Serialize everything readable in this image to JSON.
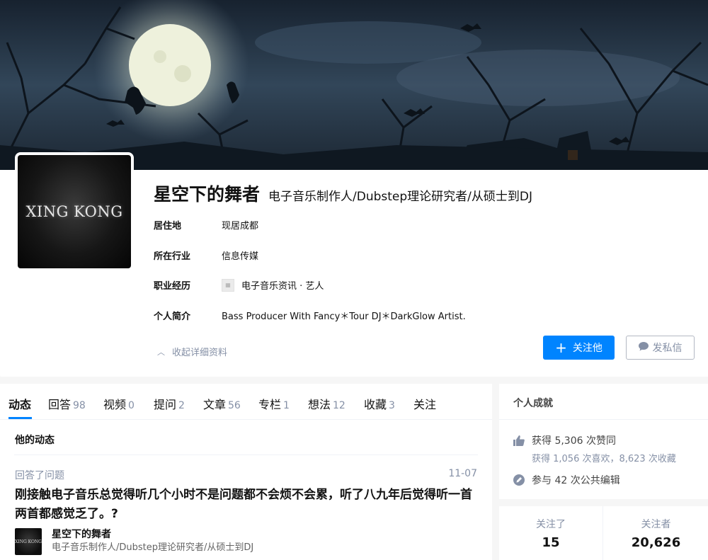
{
  "profile": {
    "name": "星空下的舞者",
    "headline": "电子音乐制作人/Dubstep理论研究者/从硕士到DJ",
    "avatar_text": "XING KONG",
    "details": [
      {
        "label": "居住地",
        "value": "现居成都"
      },
      {
        "label": "所在行业",
        "value": "信息传媒"
      },
      {
        "label": "职业经历",
        "value": "电子音乐资讯 · 艺人"
      },
      {
        "label": "个人简介",
        "value": "Bass Producer With Fancy＊Tour DJ＊DarkGlow Artist."
      }
    ],
    "collapse_label": "收起详细资料",
    "follow_button": "关注他",
    "message_button": "发私信"
  },
  "tabs": [
    {
      "label": "动态",
      "count": ""
    },
    {
      "label": "回答",
      "count": "98"
    },
    {
      "label": "视频",
      "count": "0"
    },
    {
      "label": "提问",
      "count": "2"
    },
    {
      "label": "文章",
      "count": "56"
    },
    {
      "label": "专栏",
      "count": "1"
    },
    {
      "label": "想法",
      "count": "12"
    },
    {
      "label": "收藏",
      "count": "3"
    },
    {
      "label": "关注",
      "count": ""
    }
  ],
  "feed": {
    "section_title": "他的动态",
    "item": {
      "type": "回答了问题",
      "date": "11-07",
      "question": "刚接触电子音乐总觉得听几个小时不是问题都不会烦不会累，听了八九年后觉得听一首两首都感觉乏了。?",
      "author_name": "星空下的舞者",
      "author_headline": "电子音乐制作人/Dubstep理论研究者/从硕士到DJ",
      "author_avatar_text": "XING KONG"
    }
  },
  "achievements": {
    "title": "个人成就",
    "upvotes": "获得 5,306 次赞同",
    "likes_favorites": "获得 1,056 次喜欢，8,623 次收藏",
    "edits": "参与 42 次公共编辑"
  },
  "follow_stats": {
    "following_label": "关注了",
    "following_count": "15",
    "followers_label": "关注者",
    "followers_count": "20,626"
  },
  "colors": {
    "accent": "#0084ff",
    "muted": "#8590a6",
    "text": "#121212"
  }
}
